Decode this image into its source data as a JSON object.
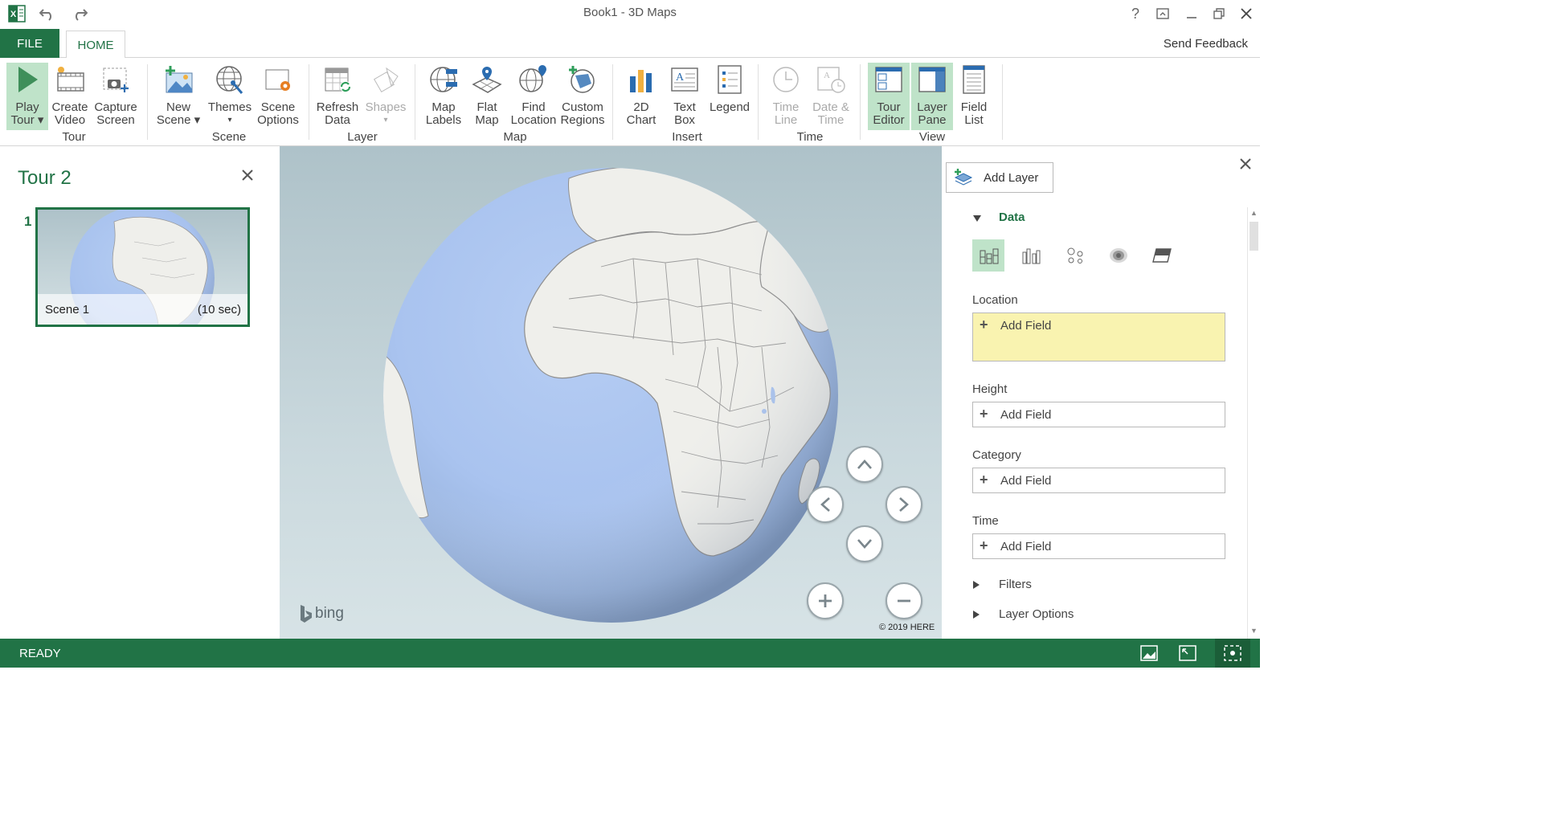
{
  "window": {
    "title": "Book1 - 3D Maps"
  },
  "tabs": {
    "file": "FILE",
    "home": "HOME",
    "feedback": "Send Feedback"
  },
  "ribbon": {
    "tour": {
      "play_l1": "Play",
      "play_l2": "Tour",
      "video_l1": "Create",
      "video_l2": "Video",
      "capture_l1": "Capture",
      "capture_l2": "Screen",
      "group": "Tour"
    },
    "scene": {
      "new_l1": "New",
      "new_l2": "Scene",
      "themes": "Themes",
      "options_l1": "Scene",
      "options_l2": "Options",
      "group": "Scene"
    },
    "layer": {
      "refresh_l1": "Refresh",
      "refresh_l2": "Data",
      "shapes": "Shapes",
      "group": "Layer"
    },
    "map": {
      "labels_l1": "Map",
      "labels_l2": "Labels",
      "flat_l1": "Flat",
      "flat_l2": "Map",
      "find_l1": "Find",
      "find_l2": "Location",
      "regions_l1": "Custom",
      "regions_l2": "Regions",
      "group": "Map"
    },
    "insert": {
      "chart_l1": "2D",
      "chart_l2": "Chart",
      "textbox_l1": "Text",
      "textbox_l2": "Box",
      "legend": "Legend",
      "group": "Insert"
    },
    "time": {
      "timeline_l1": "Time",
      "timeline_l2": "Line",
      "datetime_l1": "Date &",
      "datetime_l2": "Time",
      "group": "Time"
    },
    "view": {
      "tour_l1": "Tour",
      "tour_l2": "Editor",
      "layer_l1": "Layer",
      "layer_l2": "Pane",
      "field_l1": "Field",
      "field_l2": "List",
      "group": "View"
    }
  },
  "tour_pane": {
    "title": "Tour 2",
    "scenes": [
      {
        "number": "1",
        "name": "Scene 1",
        "duration": "(10 sec)"
      }
    ]
  },
  "map": {
    "attribution": "© 2019 HERE",
    "logo": "bing"
  },
  "layer_pane": {
    "add_layer": "Add Layer",
    "data_header": "Data",
    "location_label": "Location",
    "height_label": "Height",
    "category_label": "Category",
    "time_label": "Time",
    "add_field": "Add Field",
    "filters": "Filters",
    "layer_options": "Layer Options"
  },
  "status": {
    "text": "READY"
  },
  "colors": {
    "accent": "#217346",
    "location_box": "#f9f3b0",
    "selected": "#bfe3c9"
  }
}
